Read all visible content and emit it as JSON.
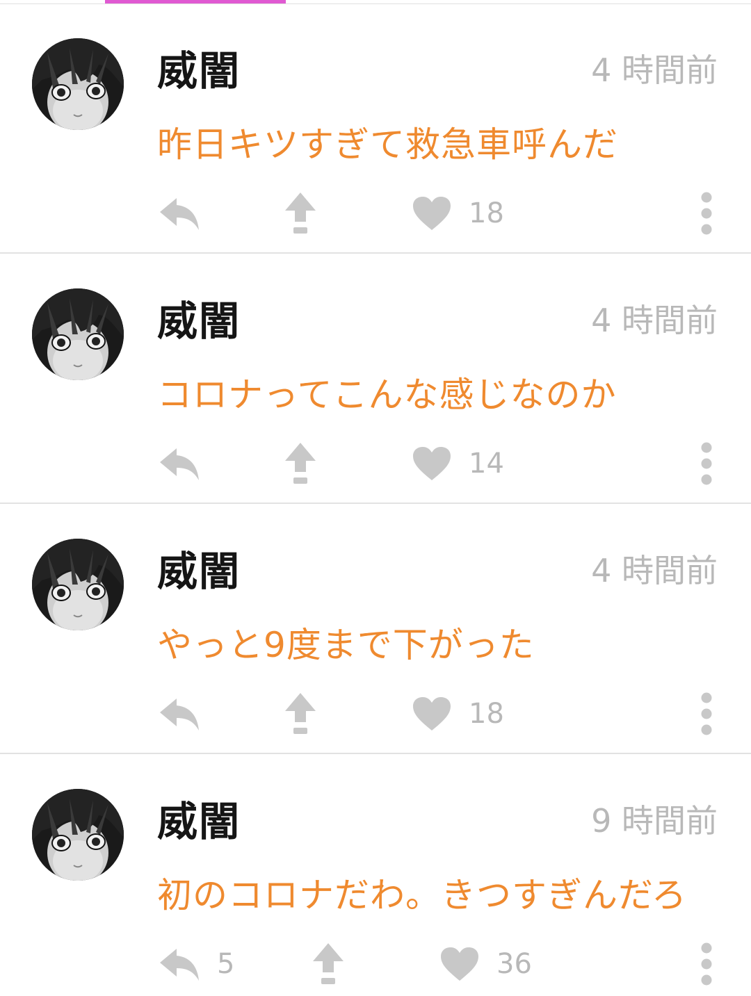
{
  "colors": {
    "accent_tab": "#e05ad2",
    "message": "#ef8a2f",
    "username": "#151515",
    "meta": "#b8b8b8",
    "icon": "#c8c8c8"
  },
  "icons": {
    "reply": "reply-icon",
    "boost": "boost-arrow-icon",
    "like": "heart-icon",
    "more": "more-vertical-icon"
  },
  "posts": [
    {
      "username": "威闇",
      "time": "4 時間前",
      "message": "昨日キツすぎて救急車呼んだ",
      "reply_count": "",
      "likes": "18"
    },
    {
      "username": "威闇",
      "time": "4 時間前",
      "message": "コロナってこんな感じなのか",
      "reply_count": "",
      "likes": "14"
    },
    {
      "username": "威闇",
      "time": "4 時間前",
      "message": "やっと9度まで下がった",
      "reply_count": "",
      "likes": "18"
    },
    {
      "username": "威闇",
      "time": "9 時間前",
      "message": "初のコロナだわ。きつすぎんだろ",
      "reply_count": "5",
      "likes": "36"
    }
  ]
}
